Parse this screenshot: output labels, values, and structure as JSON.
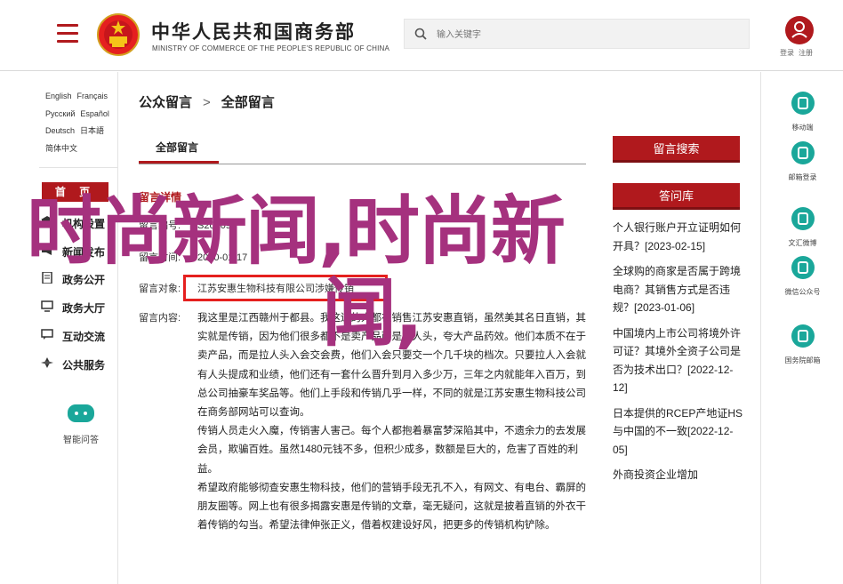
{
  "header": {
    "logo_cn": "中华人民共和国商务部",
    "logo_en": "MINISTRY OF COMMERCE OF THE PEOPLE'S REPUBLIC OF CHINA",
    "search_placeholder": "输入关键字",
    "login": "登录",
    "register": "注册"
  },
  "languages": [
    "English",
    "Français",
    "Русский",
    "Español",
    "Deutsch",
    "日本語",
    "简体中文"
  ],
  "nav": {
    "home": "首 页",
    "items": [
      {
        "label": "机构设置",
        "icon": "building-icon"
      },
      {
        "label": "新闻发布",
        "icon": "megaphone-icon"
      },
      {
        "label": "政务公开",
        "icon": "document-icon"
      },
      {
        "label": "政务大厅",
        "icon": "monitor-icon"
      },
      {
        "label": "互动交流",
        "icon": "chat-icon"
      },
      {
        "label": "公共服务",
        "icon": "service-icon"
      }
    ],
    "app_label": "智能问答"
  },
  "main": {
    "breadcrumb": [
      "公众留言",
      "全部留言"
    ],
    "breadcrumb_sep": ">",
    "tab": "全部留言",
    "section_title": "留言详情",
    "meta": [
      {
        "key": "留言编号:",
        "value": "S202097"
      },
      {
        "key": "留言时间:",
        "value": "2020-01-17"
      },
      {
        "key": "留言对象:",
        "value": "江苏安惠生物科技有限公司涉嫌传销"
      }
    ],
    "content_label": "留言内容:",
    "paragraphs": [
      "我这里是江西赣州于都县。我这边的人都在销售江苏安惠直销，虽然美其名日直销，其实就是传销，因为他们很多都不是卖产品而是拉人头，夸大产品药效。他们本质不在于卖产品，而是拉人头入会交会费，他们入会只要交一个几千块的档次。只要拉人入会就有人头提成和业绩，他们还有一套什么晋升到月入多少万，三年之内就能年入百万，到总公司抽豪车奖品等。他们上手段和传销几乎一样，不同的就是江苏安惠生物科技公司在商务部网站可以查询。",
      "传销人员走火入魔，传销害人害己。每个人都抱着暴富梦深陷其中，不遗余力的去发展会员，欺骗百姓。虽然1480元钱不多，但积少成多，数额是巨大的，危害了百姓的利益。",
      "希望政府能够彻查安惠生物科技，他们的营销手段无孔不入，有网文、有电台、霸屏的朋友圈等。网上也有很多揭露安惠是传销的文章，毫无疑问，这就是披着直销的外衣干着传销的勾当。希望法律伸张正义，借着权建设好风，把更多的传销机构铲除。"
    ]
  },
  "right": {
    "search_btn": "留言搜索",
    "faq_btn": "答问库",
    "list": [
      "个人银行账户开立证明如何开具？[2023-02-15]",
      "全球购的商家是否属于跨境电商？其销售方式是否违规？[2023-01-06]",
      "中国境内上市公司将境外许可证？其境外全资子公司是否为技术出口？[2022-12-12]",
      "日本提供的RCEP产地证HS与中国的不一致[2022-12-05]",
      "外商投资企业增加"
    ]
  },
  "share": [
    {
      "label": "移动端",
      "icon": "mobile-icon"
    },
    {
      "label": "邮箱登录",
      "icon": "mail-icon"
    },
    {
      "label": "文汇微博",
      "icon": "weibo-icon"
    },
    {
      "label": "微信公众号",
      "icon": "wechat-icon"
    },
    {
      "label": "国务院邮箱",
      "icon": "at-icon"
    }
  ],
  "overlay": {
    "line1": "时尚新闻,时尚新",
    "line2": "闻,"
  },
  "colors": {
    "accent": "#b0191d",
    "teal": "#1aa79a",
    "overlay": "#a5317e",
    "highlight": "#e5201f"
  }
}
